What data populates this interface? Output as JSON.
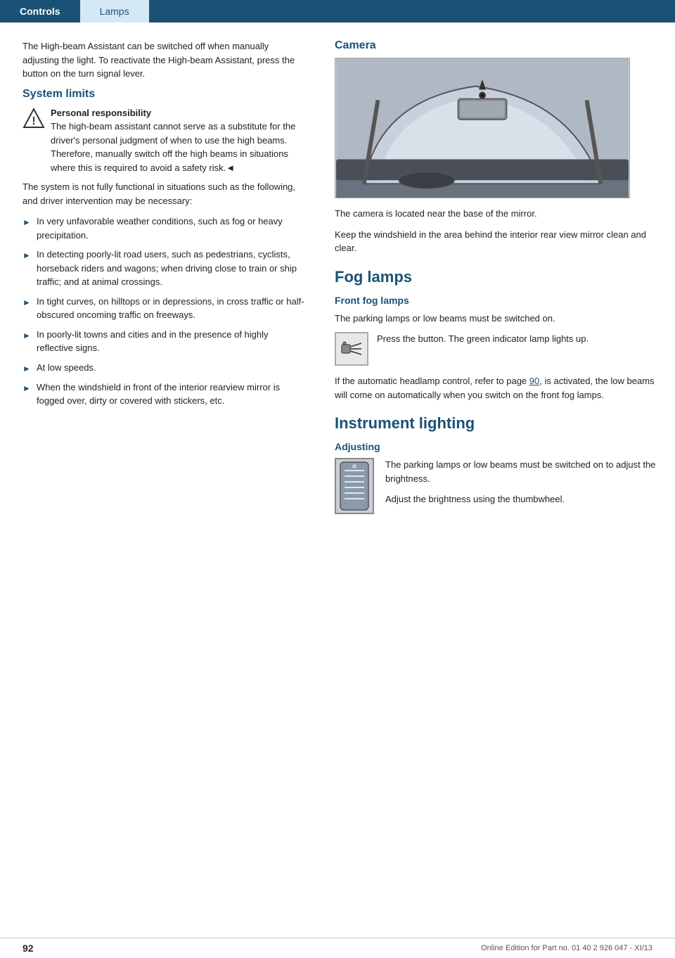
{
  "header": {
    "tab_active": "Controls",
    "tab_inactive": "Lamps"
  },
  "left_col": {
    "intro_text": "The High-beam Assistant can be switched off when manually adjusting the light. To reactivate the High-beam Assistant, press the button on the turn signal lever.",
    "system_limits": {
      "title": "System limits",
      "warning_bold": "Personal responsibility",
      "warning_text": "The high-beam assistant cannot serve as a substitute for the driver's personal judgment of when to use the high beams. Therefore, manually switch off the high beams in situations where this is required to avoid a safety risk.◄",
      "system_text": "The system is not fully functional in situations such as the following, and driver intervention may be necessary:",
      "bullets": [
        "In very unfavorable weather conditions, such as fog or heavy precipitation.",
        "In detecting poorly-lit road users, such as pedestrians, cyclists, horseback riders and wagons; when driving close to train or ship traffic; and at animal crossings.",
        "In tight curves, on hilltops or in depressions, in cross traffic or half-obscured oncoming traffic on freeways.",
        "In poorly-lit towns and cities and in the presence of highly reflective signs.",
        "At low speeds.",
        "When the windshield in front of the interior rearview mirror is fogged over, dirty or covered with stickers, etc."
      ]
    }
  },
  "right_col": {
    "camera": {
      "title": "Camera",
      "text1": "The camera is located near the base of the mirror.",
      "text2": "Keep the windshield in the area behind the interior rear view mirror clean and clear."
    },
    "fog_lamps": {
      "title": "Fog lamps",
      "front_fog_lamps": {
        "subtitle": "Front fog lamps",
        "text1": "The parking lamps or low beams must be switched on.",
        "button_text": "Press the button. The green indicator lamp lights up.",
        "text2_prefix": "If the automatic headlamp control, refer to page ",
        "text2_link": "90",
        "text2_suffix": ", is activated, the low beams will come on automatically when you switch on the front fog lamps."
      }
    },
    "instrument_lighting": {
      "title": "Instrument lighting",
      "adjusting": {
        "subtitle": "Adjusting",
        "text1": "The parking lamps or low beams must be switched on to adjust the brightness.",
        "text2": "Adjust the brightness using the thumbwheel."
      }
    }
  },
  "footer": {
    "page_number": "92",
    "footer_text": "Online Edition for Part no. 01 40 2 926 047 - XI/13"
  }
}
